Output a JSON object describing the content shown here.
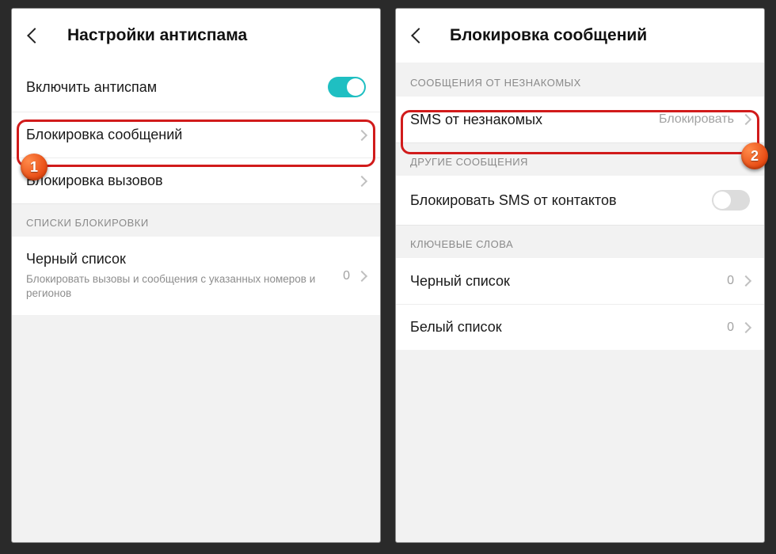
{
  "left": {
    "title": "Настройки антиспама",
    "enable_antispam": "Включить антиспам",
    "enable_antispam_on": true,
    "msg_block": "Блокировка сообщений",
    "call_block": "Блокировка вызовов",
    "section_blocklists": "СПИСКИ БЛОКИРОВКИ",
    "blacklist": "Черный список",
    "blacklist_sub": "Блокировать вызовы и сообщения с указанных номеров и регионов",
    "blacklist_count": "0"
  },
  "right": {
    "title": "Блокировка сообщений",
    "section_unknown": "СООБЩЕНИЯ ОТ НЕЗНАКОМЫХ",
    "sms_unknown": "SMS от незнакомых",
    "sms_unknown_value": "Блокировать",
    "section_other": "ДРУГИЕ СООБЩЕНИЯ",
    "block_contacts": "Блокировать SMS от контактов",
    "block_contacts_on": false,
    "section_keywords": "КЛЮЧЕВЫЕ СЛОВА",
    "blacklist": "Черный список",
    "blacklist_count": "0",
    "whitelist": "Белый список",
    "whitelist_count": "0"
  },
  "badges": {
    "one": "1",
    "two": "2"
  }
}
